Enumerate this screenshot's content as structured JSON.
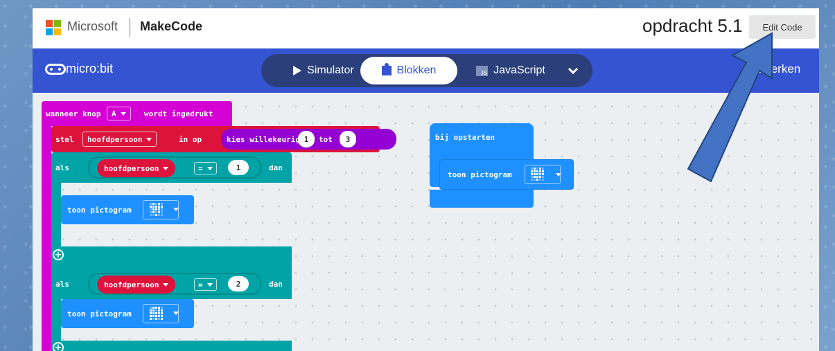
{
  "header": {
    "microsoft": "Microsoft",
    "makecode": "MakeCode",
    "project_title": "opdracht 5.1",
    "edit_code_label": "Edit Code",
    "ms_colors": [
      "#f25022",
      "#7fba00",
      "#00a4ef",
      "#ffb900"
    ]
  },
  "navbar": {
    "brand": "micro:bit",
    "tabs": {
      "simulator": "Simulator",
      "blocks": "Blokken",
      "javascript": "JavaScript"
    },
    "js_badge": "JS",
    "edit_label": "ewerken"
  },
  "blocks": {
    "event": {
      "wanneer": "wanneer knop",
      "button": "A",
      "pressed": "wordt ingedrukt"
    },
    "set": {
      "stel": "stel",
      "variable": "hoofdpersoon",
      "in_op": "in op",
      "random": "kies willekeurig",
      "from": "1",
      "tot": "tot",
      "to": "3"
    },
    "if1": {
      "als": "als",
      "variable": "hoofdpersoon",
      "op": "=",
      "value": "1",
      "dan": "dan"
    },
    "show1": {
      "label": "toon pictogram"
    },
    "if2": {
      "als": "als",
      "variable": "hoofdpersoon",
      "op": "=",
      "value": "2",
      "dan": "dan"
    },
    "show2": {
      "label": "toon pictogram"
    },
    "start": {
      "label": "bij opstarten"
    },
    "show3": {
      "label": "toon pictogram"
    },
    "plus": "+"
  },
  "colors": {
    "event": "#d400d4",
    "variables": "#dc143c",
    "logic": "#00a4a6",
    "math": "#9400d3",
    "basic": "#1e90ff",
    "arrow": "#4472c4"
  }
}
